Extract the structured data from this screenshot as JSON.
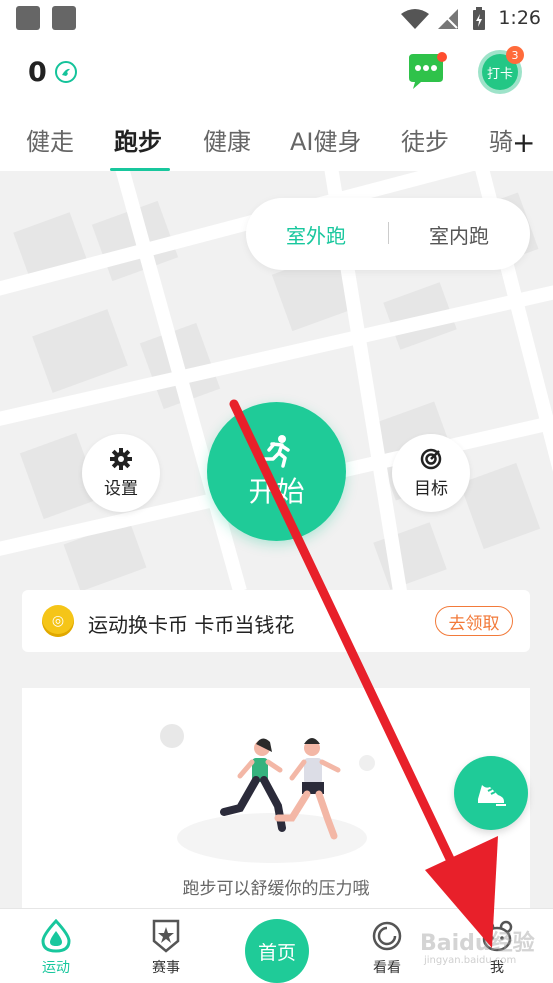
{
  "status_bar": {
    "time": "1:26"
  },
  "header": {
    "coin_count": "0",
    "checkin_label": "打卡",
    "checkin_badge": "3"
  },
  "tabs": [
    {
      "label": "健走"
    },
    {
      "label": "跑步"
    },
    {
      "label": "健康"
    },
    {
      "label": "AI健身"
    },
    {
      "label": "徒步"
    },
    {
      "label": "骑"
    }
  ],
  "tab_add_label": "+",
  "run_mode": {
    "outdoor": "室外跑",
    "indoor": "室内跑"
  },
  "controls": {
    "settings": "设置",
    "start": "开始",
    "goal": "目标"
  },
  "promo": {
    "text": "运动换卡币 卡币当钱花",
    "button": "去领取"
  },
  "illustration_caption": "跑步可以舒缓你的压力哦",
  "bottom_nav": {
    "sport": "运动",
    "events": "赛事",
    "home": "首页",
    "watch": "看看",
    "me": "我"
  },
  "watermark": {
    "brand": "Baidu经验",
    "url": "jingyan.baidu.com"
  },
  "colors": {
    "accent": "#1fcb98",
    "orange": "#f27a3a",
    "arrow": "#e8202a"
  }
}
